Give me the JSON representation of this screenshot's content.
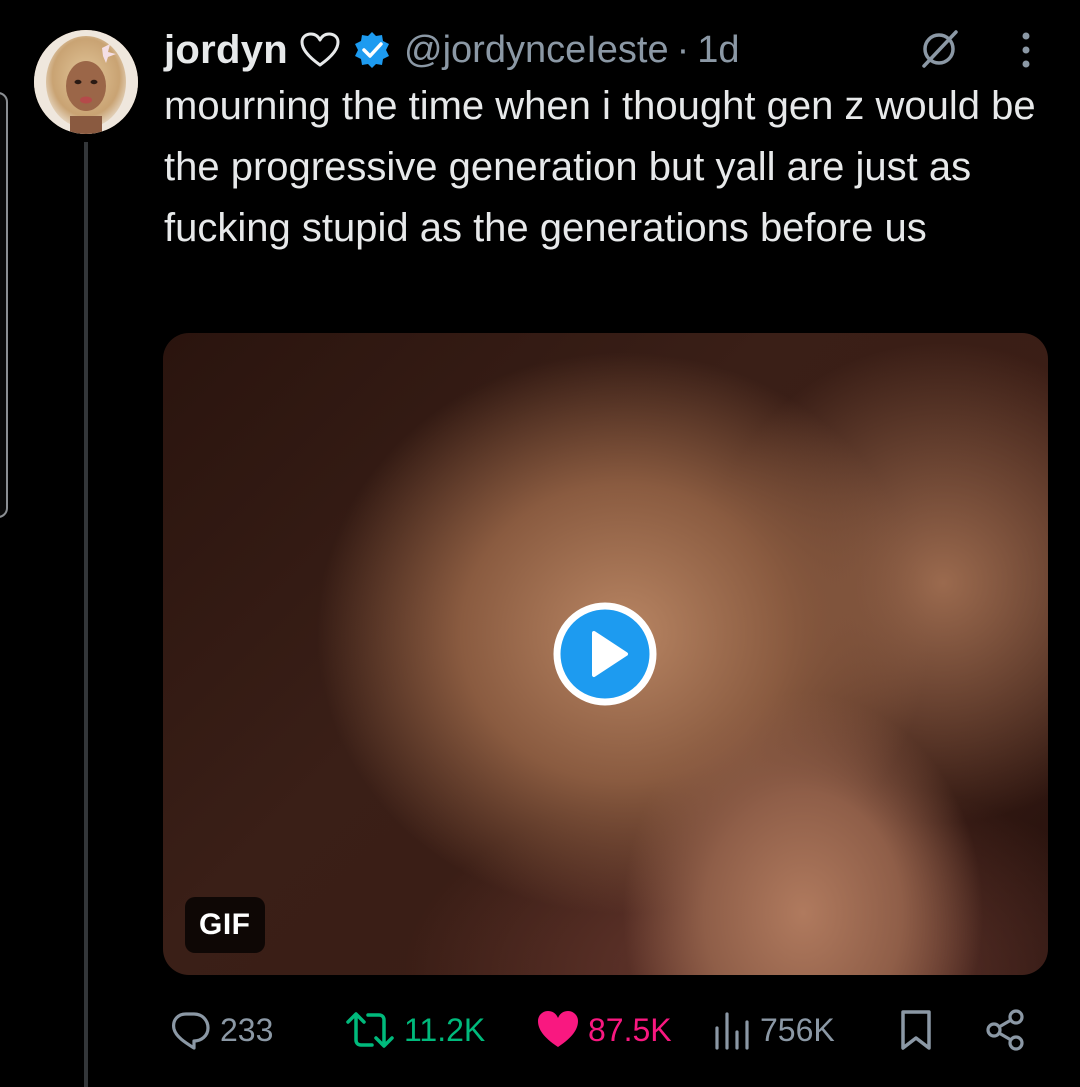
{
  "tweet": {
    "author": {
      "display_name": "jordyn",
      "name_emoji_icon": "heart-outline-icon",
      "verified_icon": "verified-badge-icon",
      "handle": "@jordynceIeste",
      "separator": "·",
      "time": "1d"
    },
    "text": "mourning the time when i thought gen z would be the progressive generation but yall are just as fucking stupid as the generations before us",
    "media": {
      "badge": "GIF",
      "play_icon": "play-icon"
    },
    "actions": {
      "replies": "233",
      "reposts": "11.2K",
      "likes": "87.5K",
      "views": "756K"
    }
  },
  "colors": {
    "background": "#000000",
    "text": "#e7e9ea",
    "muted": "#8b98a5",
    "verified": "#1d9bf0",
    "repost": "#00ba7c",
    "like": "#f91880",
    "play": "#1d9bf0"
  }
}
